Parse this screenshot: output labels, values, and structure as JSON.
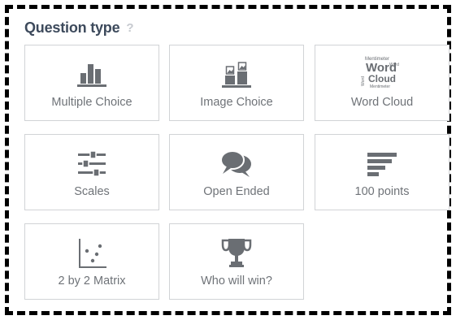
{
  "section": {
    "title": "Question type",
    "help_glyph": "?"
  },
  "tiles": [
    {
      "label": "Multiple Choice",
      "icon": "bar-chart-icon"
    },
    {
      "label": "Image Choice",
      "icon": "image-choice-icon"
    },
    {
      "label": "Word Cloud",
      "icon": "word-cloud-icon"
    },
    {
      "label": "Scales",
      "icon": "sliders-icon"
    },
    {
      "label": "Open Ended",
      "icon": "speech-bubbles-icon"
    },
    {
      "label": "100 points",
      "icon": "horizontal-bars-icon"
    },
    {
      "label": "2 by 2 Matrix",
      "icon": "scatter-matrix-icon"
    },
    {
      "label": "Who will win?",
      "icon": "trophy-icon"
    }
  ],
  "word_cloud_icon": {
    "words": [
      "Mentimeter",
      "Word",
      "Word",
      "Cloud",
      "Word",
      "Mentimeter"
    ]
  },
  "colors": {
    "title": "#3d4a5c",
    "icon": "#6a6e73",
    "label": "#6f7378",
    "tile_border": "#d1d3d6",
    "frame_dash": "#000000"
  }
}
